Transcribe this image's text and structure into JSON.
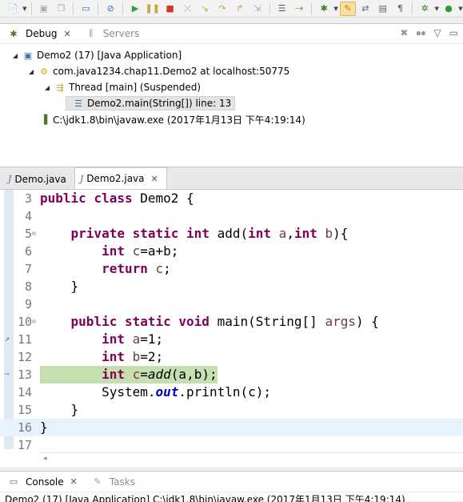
{
  "toolbar": {
    "buttons": [
      "new-icon",
      "save-icon",
      "save-all-icon",
      "debug-view-icon",
      "skip-breakpoints-icon",
      "resume-icon",
      "suspend-icon",
      "terminate-icon",
      "disconnect-icon",
      "step-into-icon",
      "step-over-icon",
      "step-return-icon",
      "drop-to-frame-icon",
      "use-step-filters-icon",
      "run-icon"
    ]
  },
  "debug": {
    "tabs": [
      {
        "label": "Debug"
      },
      {
        "label": "Servers"
      }
    ],
    "tree": [
      {
        "label": "Demo2 (17) [Java Application]"
      },
      {
        "label": "com.java1234.chap11.Demo2 at localhost:50775"
      },
      {
        "label": "Thread [main] (Suspended)"
      },
      {
        "label": "Demo2.main(String[]) line: 13"
      },
      {
        "label": "C:\\jdk1.8\\bin\\javaw.exe (2017年1月13日 下午4:19:14)"
      }
    ]
  },
  "editor": {
    "tabs": [
      {
        "label": "Demo.java"
      },
      {
        "label": "Demo2.java"
      }
    ],
    "lines": [
      {
        "n": "3"
      },
      {
        "n": "4"
      },
      {
        "n": "5"
      },
      {
        "n": "6"
      },
      {
        "n": "7"
      },
      {
        "n": "8"
      },
      {
        "n": "9"
      },
      {
        "n": "10"
      },
      {
        "n": "11"
      },
      {
        "n": "12"
      },
      {
        "n": "13"
      },
      {
        "n": "14"
      },
      {
        "n": "15"
      },
      {
        "n": "16"
      },
      {
        "n": "17"
      }
    ],
    "code": {
      "l3a": "public",
      "l3b": " ",
      "l3c": "class",
      "l3d": " Demo2 {",
      "l5a": "private",
      "l5b": "static",
      "l5c": "int",
      "l5d": " add(",
      "l5e": "int",
      "l5f": "a",
      "l5g": ",",
      "l5h": "int",
      "l5i": "b",
      "l5j": "){",
      "l6a": "int",
      "l6b": "c",
      "l6c": "=a+b;",
      "l7a": "return",
      "l7b": "c",
      "l7c": ";",
      "l8": "}",
      "l10a": "public",
      "l10b": "static",
      "l10c": "void",
      "l10d": " main(String[] ",
      "l10e": "args",
      "l10f": ") {",
      "l11a": "int",
      "l11b": "a",
      "l11c": "=1;",
      "l12a": "int",
      "l12b": "b",
      "l12c": "=2;",
      "l13a": "int",
      "l13b": "c",
      "l13c": "=",
      "l13d": "add",
      "l13e": "(a,b);",
      "l14a": "System.",
      "l14b": "out",
      "l14c": ".println(c);",
      "l15": "}",
      "l16": "}"
    }
  },
  "console": {
    "tabs": [
      {
        "label": "Console"
      },
      {
        "label": "Tasks"
      }
    ],
    "text": "Demo2 (17) [Java Application] C:\\jdk1.8\\bin\\javaw.exe (2017年1月13日 下午4:19:14)"
  }
}
